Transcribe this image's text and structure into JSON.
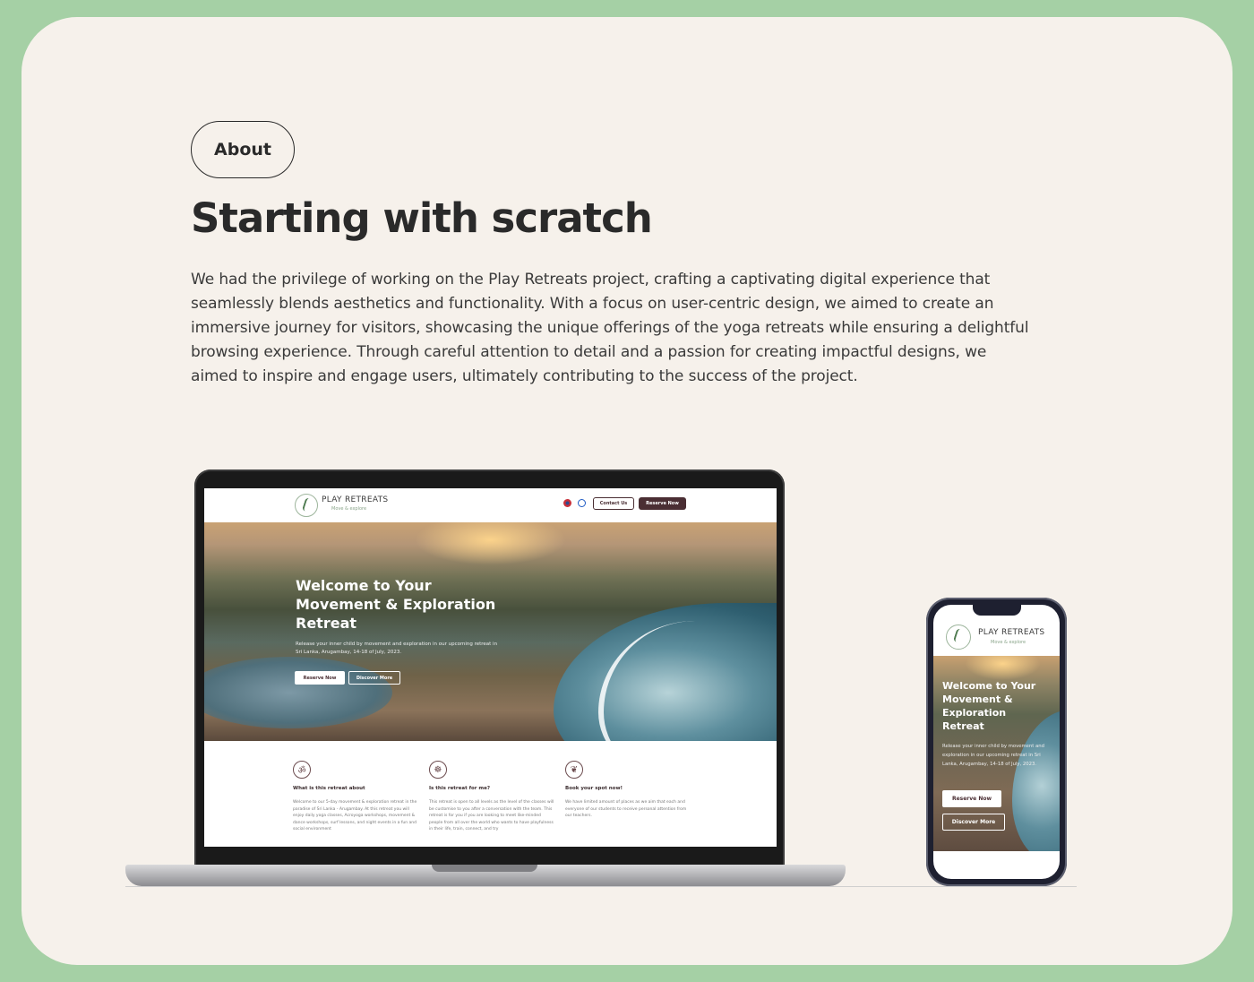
{
  "section": {
    "tag": "About",
    "heading": "Starting with scratch",
    "paragraph_lines": [
      "We had the privilege of working on the Play Retreats project, crafting a captivating digital experience that",
      "seamlessly blends aesthetics and functionality. With a focus on user-centric design, we aimed to create an",
      "immersive journey for visitors, showcasing the unique offerings of the yoga retreats while ensuring a delightful",
      "browsing experience. Through careful attention to detail and a passion for creating impactful designs, we",
      "aimed to inspire and engage users, ultimately contributing to the success of the project."
    ]
  },
  "colors": {
    "outer_background": "#a5d0a5",
    "card_background": "#f6f1eb",
    "text_dark": "#2a2a2a",
    "brand_button": "#4a2e33"
  },
  "mockup_site": {
    "logo_title": "PLAY RETREATS",
    "logo_tagline": "Move & explore",
    "contact_button": "Contact Us",
    "reserve_button": "Reserve Now",
    "hero_title_lines": [
      "Welcome to Your",
      "Movement & Exploration",
      "Retreat"
    ],
    "hero_text": "Release your inner child by movement and exploration in our upcoming retreat in Sri Lanka, Arugambay, 14-18 of July, 2023.",
    "hero_primary_button": "Reserve Now",
    "hero_secondary_button": "Discover More",
    "features": [
      {
        "icon": "om-icon",
        "title": "What is this retreat about",
        "text": "Welcome to our 5-day movement & exploration retreat in the paradise of Sri Lanka - Arugambay. At this retreat you will enjoy daily yoga classes, Acroyoga workshops, movement & dance workshops, surf lessons, and night events in a fun and social environment"
      },
      {
        "icon": "meditation-icon",
        "title": "Is this retreat for me?",
        "text": "This retreat is open to all levels as the level of the classes will be customise to you after a conversation with the team. This retreat is for you if you are looking to meet like-minded people from all over the world who wants to have playfulness in their life, train, connect, and try"
      },
      {
        "icon": "lotus-icon",
        "title": "Book your spot now!",
        "text": "We have limited amount of places as we aim that each and everyone of our students to receive personal attention from our teachers."
      }
    ]
  },
  "mockup_phone": {
    "logo_title": "PLAY RETREATS",
    "logo_tagline": "Move & explore",
    "hero_title_lines": [
      "Welcome to Your",
      "Movement &",
      "Exploration",
      "Retreat"
    ],
    "hero_text": "Release your inner child by movement and exploration in our upcoming retreat in Sri Lanka, Arugambay, 14-18 of July, 2023.",
    "primary_button": "Reserve Now",
    "secondary_button": "Discover More"
  }
}
